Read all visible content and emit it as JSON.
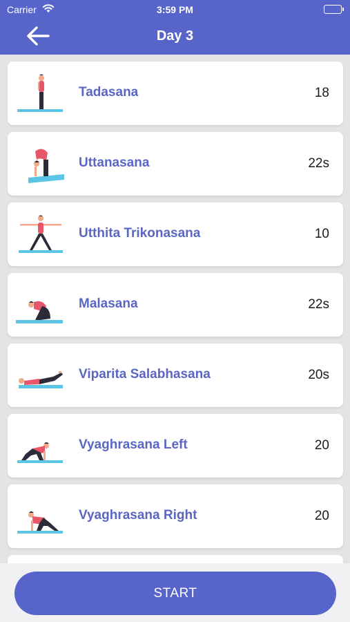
{
  "status_bar": {
    "carrier": "Carrier",
    "time": "3:59 PM"
  },
  "nav": {
    "title": "Day 3",
    "back_icon": "arrow-left-icon"
  },
  "exercises": [
    {
      "name": "Tadasana",
      "duration": "18",
      "pose": "standing"
    },
    {
      "name": "Uttanasana",
      "duration": "22s",
      "pose": "forward-fold"
    },
    {
      "name": "Utthita Trikonasana",
      "duration": "10",
      "pose": "triangle"
    },
    {
      "name": "Malasana",
      "duration": "22s",
      "pose": "squat"
    },
    {
      "name": "Viparita Salabhasana",
      "duration": "20s",
      "pose": "locust"
    },
    {
      "name": "Vyaghrasana Left",
      "duration": "20",
      "pose": "tiger"
    },
    {
      "name": "Vyaghrasana Right",
      "duration": "20",
      "pose": "tiger"
    }
  ],
  "start_button": {
    "label": "START"
  },
  "colors": {
    "primary": "#5765cb",
    "exercise_name": "#5a66c4",
    "mat": "#5cc4e4",
    "shirt": "#e8566a",
    "skin": "#f1a98a"
  }
}
